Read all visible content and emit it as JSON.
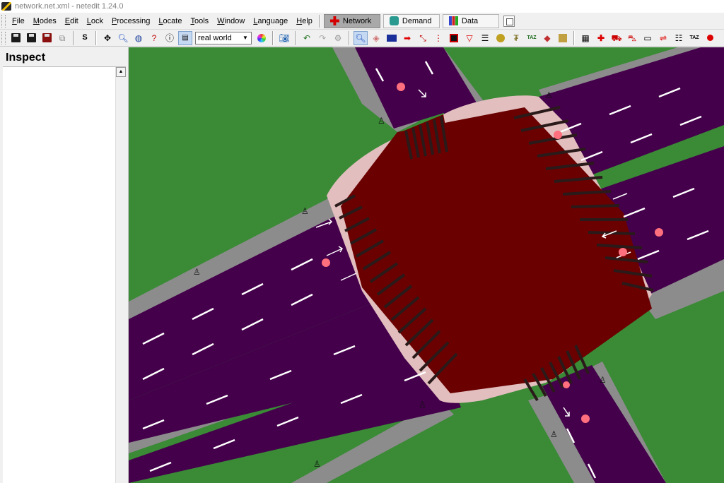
{
  "window": {
    "title": "network.net.xml - netedit 1.24.0"
  },
  "menu": {
    "items": [
      "File",
      "Modes",
      "Edit",
      "Lock",
      "Processing",
      "Locate",
      "Tools",
      "Window",
      "Language",
      "Help"
    ],
    "modes": [
      {
        "label": "Network",
        "icon": "network-plus-icon",
        "active": true
      },
      {
        "label": "Demand",
        "icon": "demand-car-icon",
        "active": false
      },
      {
        "label": "Data",
        "icon": "data-chart-icon",
        "active": false
      }
    ]
  },
  "toolbar": {
    "s_label": "S",
    "scheme_value": "real world",
    "icons": [
      "save-network-icon",
      "save-all-icon",
      "save-demand-icon",
      "reload-icon",
      "recenter-view-icon",
      "zoom-icon",
      "locate-junction-icon",
      "locate-edge-icon",
      "locate-vehicle-icon",
      "menu-icon",
      "color-wheel-icon",
      "screenshot-icon",
      "undo-icon",
      "redo-icon",
      "inspect-mode-icon",
      "delete-mode-icon",
      "select-mode-icon",
      "move-mode-icon",
      "create-edge-icon",
      "connection-mode-icon",
      "traffic-light-icon",
      "additional-icon",
      "crossing-icon",
      "taz-icon",
      "shape-icon",
      "prohibition-icon"
    ],
    "colors": {
      "selected_bg": "#c6d9f2"
    }
  },
  "inspect": {
    "title": "Inspect"
  },
  "canvas": {
    "colors": {
      "background": "#3a8a36",
      "road": "#44004b",
      "sidewalk": "#8c8c8c",
      "junction": "#6b0000",
      "junction_edge": "#e2bebe",
      "crossing_stripe": "#4a2a2a",
      "lane_marking": "#ffffff",
      "detector": "#ff6f7d"
    }
  }
}
